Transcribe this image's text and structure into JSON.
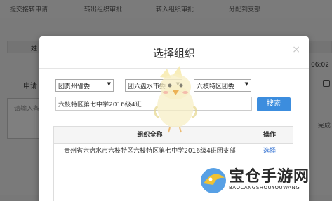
{
  "background": {
    "tabs": [
      "提交接转申请",
      "转出组织审批",
      "转入组织审批",
      "分配到支部"
    ],
    "column_label": "姓",
    "time_fragment": "06:02",
    "row_label": "申请",
    "textarea_placeholder": "请输入备",
    "done_label": "完成"
  },
  "modal": {
    "title": "选择组织",
    "close_label": "×",
    "selects": [
      {
        "value": "团贵州省委"
      },
      {
        "value": "团六盘水市委"
      },
      {
        "value": "六枝特区团委"
      }
    ],
    "search_value": "六枝特区第七中学2016级4班",
    "search_button": "搜索",
    "table": {
      "headers": [
        "组织全称",
        "操作"
      ],
      "rows": [
        {
          "name": "贵州省六盘水市六枝特区六枝特区第七中学2016级4班团支部",
          "action": "选择"
        }
      ]
    }
  },
  "watermark": {
    "title": "宝仓手游网",
    "subtitle": "BAOCANGSHOUYOUWANG"
  }
}
